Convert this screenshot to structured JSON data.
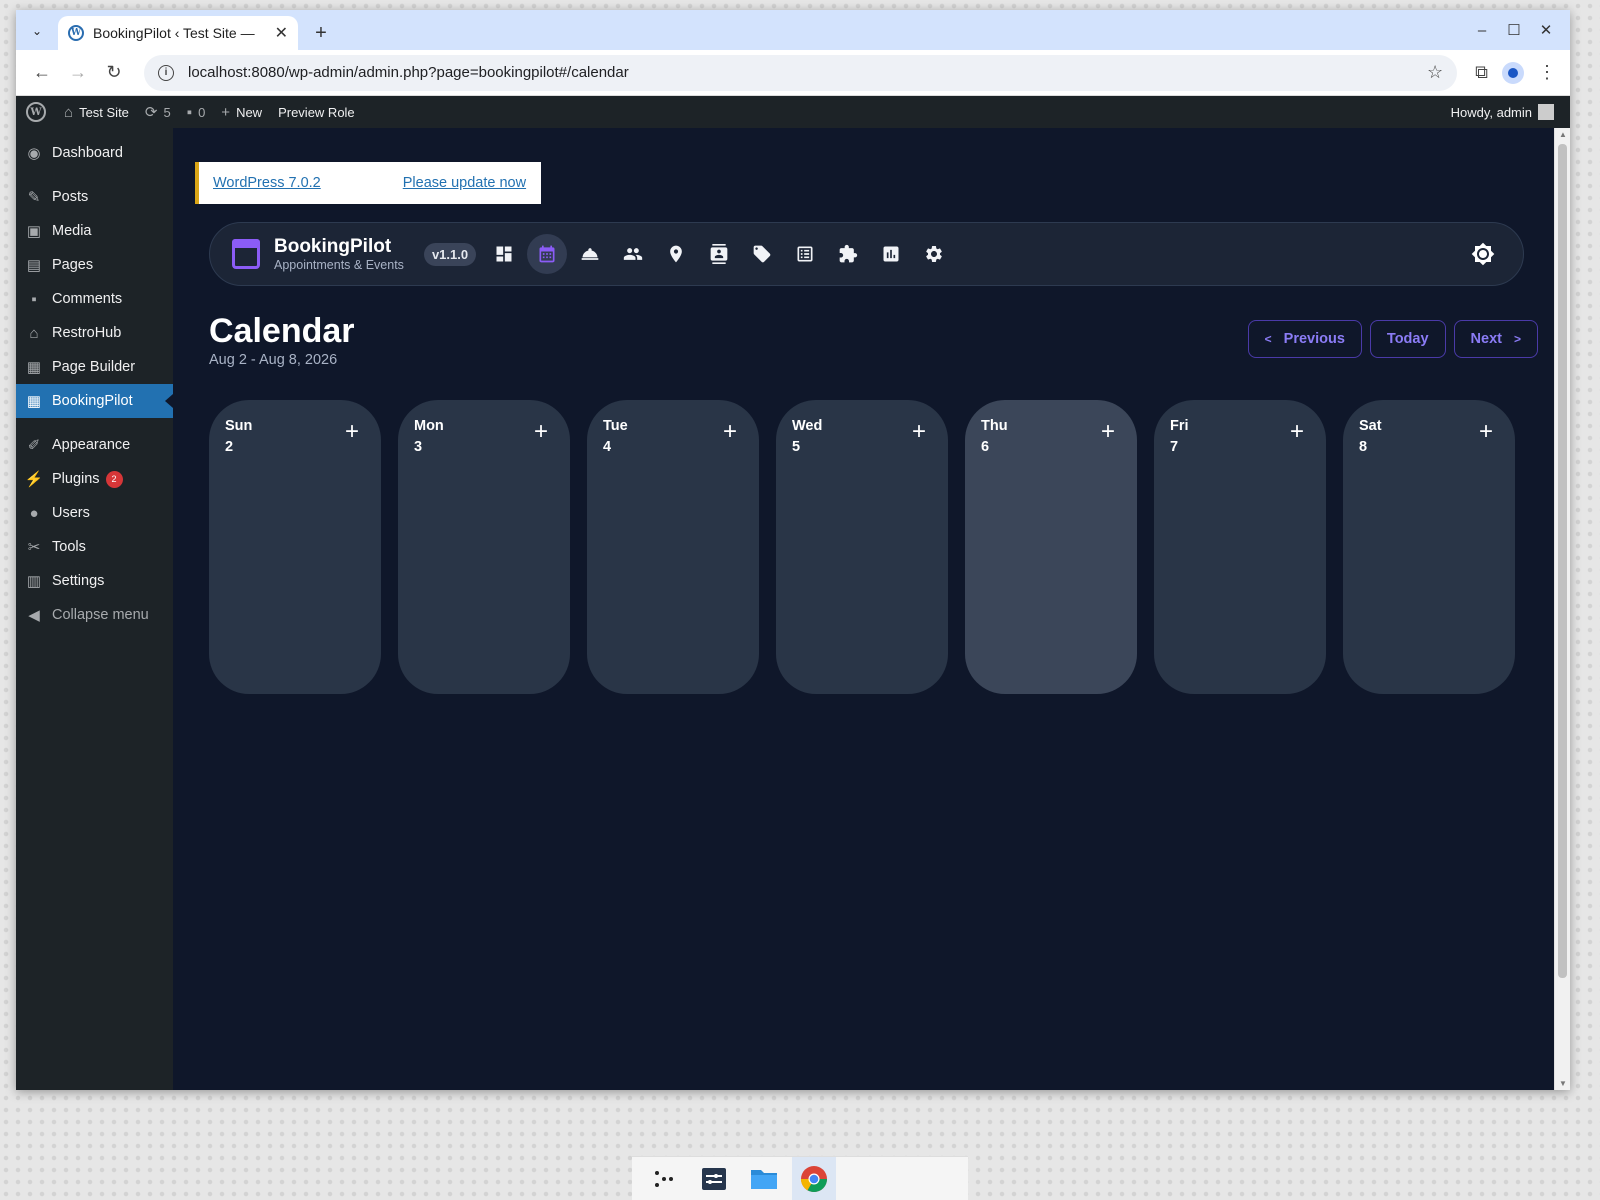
{
  "browser": {
    "tab_title": "BookingPilot ‹ Test Site —",
    "url": "localhost:8080/wp-admin/admin.php?page=bookingpilot#/calendar"
  },
  "adminbar": {
    "site_name": "Test Site",
    "updates_count": "5",
    "comments_count": "0",
    "new_label": "New",
    "preview_role": "Preview Role",
    "howdy": "Howdy, admin"
  },
  "sidebar": {
    "items": [
      {
        "label": "Dashboard",
        "icon": "dashboard-icon"
      },
      {
        "label": "Posts",
        "icon": "pin-icon"
      },
      {
        "label": "Media",
        "icon": "media-icon"
      },
      {
        "label": "Pages",
        "icon": "pages-icon"
      },
      {
        "label": "Comments",
        "icon": "comment-icon"
      },
      {
        "label": "RestroHub",
        "icon": "store-icon"
      },
      {
        "label": "Page Builder",
        "icon": "layout-icon"
      },
      {
        "label": "BookingPilot",
        "icon": "calendar-icon"
      },
      {
        "label": "Appearance",
        "icon": "brush-icon"
      },
      {
        "label": "Plugins",
        "icon": "plugin-icon",
        "badge": "2"
      },
      {
        "label": "Users",
        "icon": "user-icon"
      },
      {
        "label": "Tools",
        "icon": "wrench-icon"
      },
      {
        "label": "Settings",
        "icon": "settings-icon"
      },
      {
        "label": "Collapse menu",
        "icon": "collapse-icon"
      }
    ]
  },
  "notice": {
    "version_link": "WordPress 7.0.2",
    "update_link": "Please update now"
  },
  "plugin": {
    "name": "BookingPilot",
    "tagline": "Appointments & Events",
    "version": "v1.1.0"
  },
  "calendar": {
    "title": "Calendar",
    "range": "Aug 2 - Aug 8, 2026",
    "prev_label": "Previous",
    "today_label": "Today",
    "next_label": "Next",
    "days": [
      {
        "name": "Sun",
        "num": "2"
      },
      {
        "name": "Mon",
        "num": "3"
      },
      {
        "name": "Tue",
        "num": "4"
      },
      {
        "name": "Wed",
        "num": "5"
      },
      {
        "name": "Thu",
        "num": "6"
      },
      {
        "name": "Fri",
        "num": "7"
      },
      {
        "name": "Sat",
        "num": "8"
      }
    ],
    "add_symbol": "+"
  },
  "colors": {
    "accent": "#8b5cf6",
    "content_bg": "#0f172a",
    "wp_active": "#2271b1"
  }
}
